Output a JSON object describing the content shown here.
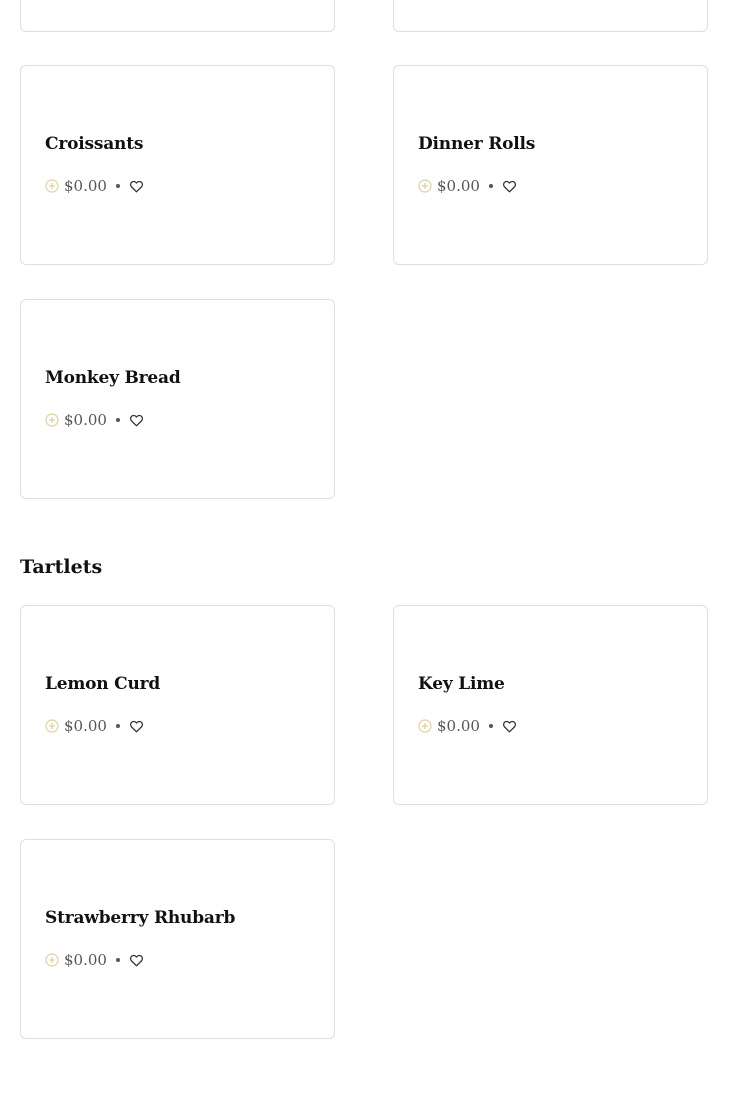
{
  "sections": [
    {
      "title": "",
      "items": [
        {
          "name": "Croissants",
          "price": "$0.00"
        },
        {
          "name": "Dinner Rolls",
          "price": "$0.00"
        },
        {
          "name": "Monkey Bread",
          "price": "$0.00"
        }
      ]
    },
    {
      "title": "Tartlets",
      "items": [
        {
          "name": "Lemon Curd",
          "price": "$0.00"
        },
        {
          "name": "Key Lime",
          "price": "$0.00"
        },
        {
          "name": "Strawberry Rhubarb",
          "price": "$0.00"
        }
      ]
    }
  ],
  "icons": {
    "add": "plus-circle-icon",
    "favorite": "heart-icon"
  },
  "colors": {
    "card_border": "#dedede",
    "add_icon": "#e2cf9e",
    "price_text": "#555555",
    "title_text": "#111111"
  }
}
